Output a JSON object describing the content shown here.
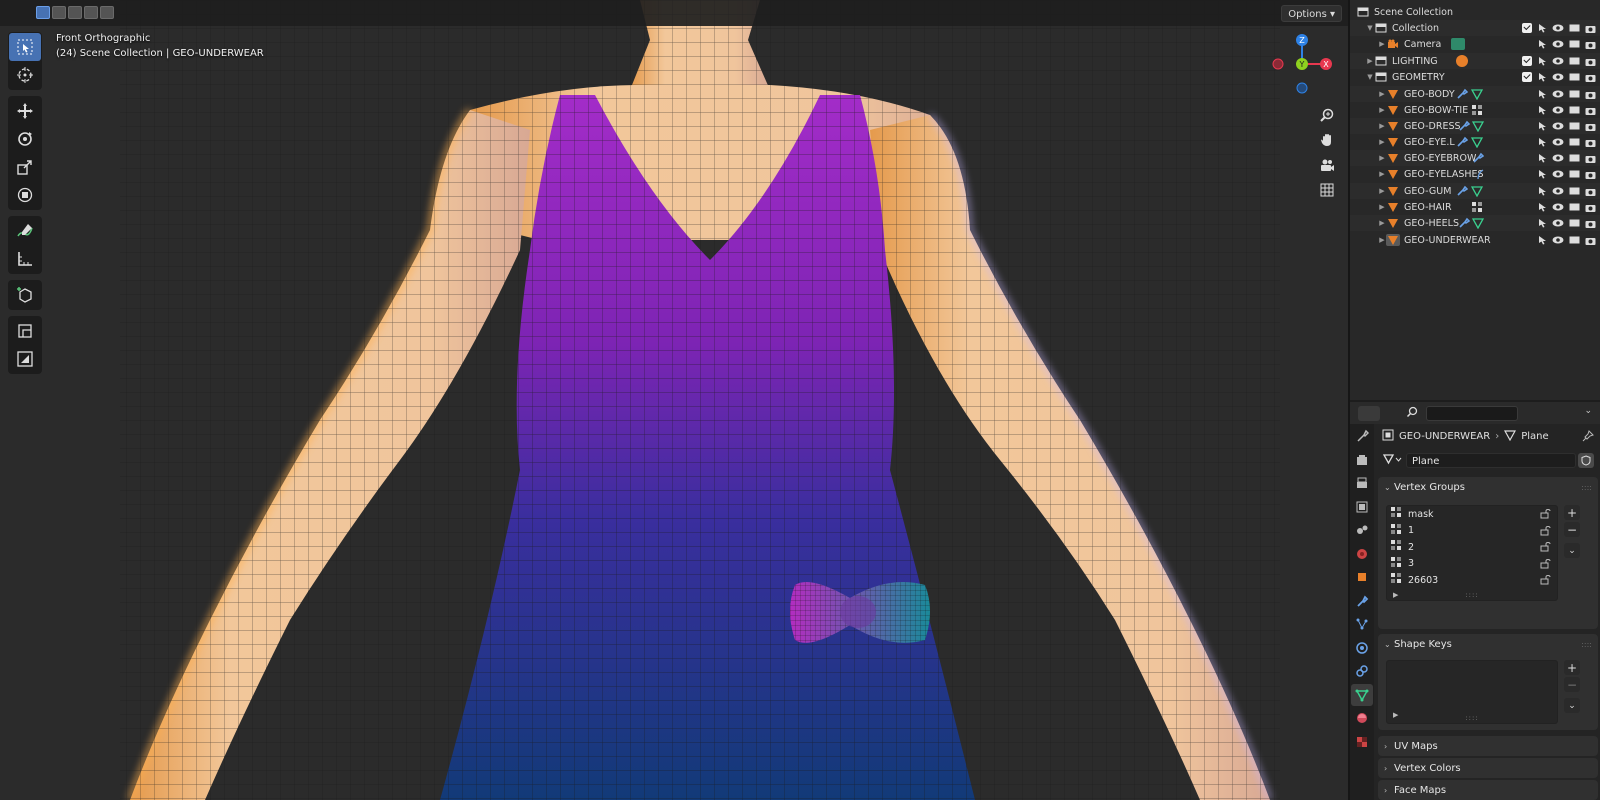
{
  "viewport": {
    "view_name": "Front Orthographic",
    "context": "(24) Scene Collection | GEO-UNDERWEAR",
    "options_label": "Options"
  },
  "toolbar": {
    "tools": [
      "select-box-icon",
      "cursor-icon",
      "move-icon",
      "rotate-icon",
      "scale-icon",
      "transform-icon",
      "annotate-icon",
      "measure-icon",
      "add-cube-icon",
      "extrude-icon",
      "inset-icon"
    ]
  },
  "gizmo": {
    "x": "X",
    "y": "Y",
    "z": "Z",
    "x_color": "#e8384f",
    "y_color": "#8ed11f",
    "z_color": "#2e82e6"
  },
  "outliner": {
    "root": "Scene Collection",
    "collection": "Collection",
    "camera": "Camera",
    "lighting": "LIGHTING",
    "geometry": "GEOMETRY",
    "objects": [
      "GEO-BODY",
      "GEO-BOW-TIE",
      "GEO-DRESS",
      "GEO-EYE.L",
      "GEO-EYEBROW",
      "GEO-EYELASHES",
      "GEO-GUM",
      "GEO-HAIR",
      "GEO-HEELS",
      "GEO-UNDERWEAR"
    ]
  },
  "properties": {
    "object_name": "GEO-UNDERWEAR",
    "data_name": "Plane",
    "mesh_name": "Plane",
    "vertex_groups_title": "Vertex Groups",
    "vertex_groups": [
      "mask",
      "1",
      "2",
      "3",
      "26603"
    ],
    "shape_keys_title": "Shape Keys",
    "uv_maps_title": "UV Maps",
    "vertex_colors_title": "Vertex Colors",
    "face_maps_title": "Face Maps"
  },
  "colors": {
    "accent": "#4772b3",
    "mesh_orange": "#e8802a",
    "mesh_green": "#3ad08f"
  }
}
